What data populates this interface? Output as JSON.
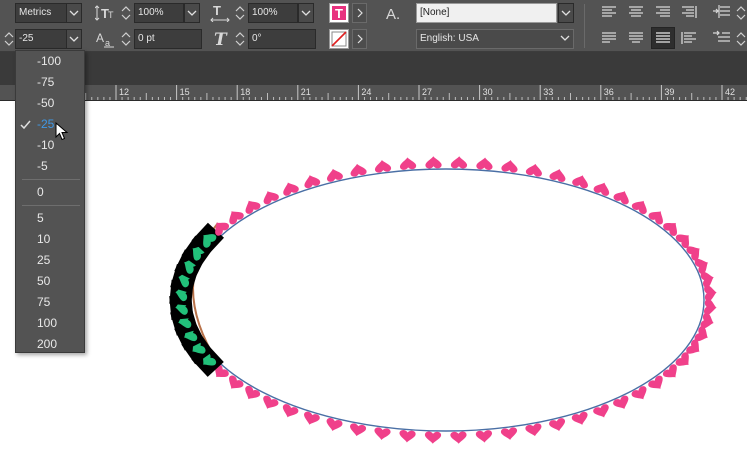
{
  "toolbar": {
    "kerning_method": "Metrics",
    "tracking_value": "-25",
    "vertical_scale": "100%",
    "horizontal_scale": "100%",
    "baseline_shift": "0 pt",
    "skew": "0°",
    "char_style": "[None]",
    "language": "English: USA",
    "type_tool_letter": "T",
    "char_style_icon_label": "A."
  },
  "ruler": {
    "ticks": [
      "12",
      "15",
      "18",
      "21",
      "24",
      "27",
      "30",
      "33",
      "36",
      "39",
      "42"
    ]
  },
  "kerning_menu": {
    "items": [
      "-100",
      "-75",
      "-50",
      "-25",
      "-10",
      "-5",
      "0",
      "5",
      "10",
      "25",
      "50",
      "75",
      "100",
      "200"
    ],
    "selected": "-25"
  },
  "canvas": {
    "heart_color": "#f0408a",
    "selected_heart_color": "#22c07a",
    "path_color": "#4a6fa5"
  }
}
